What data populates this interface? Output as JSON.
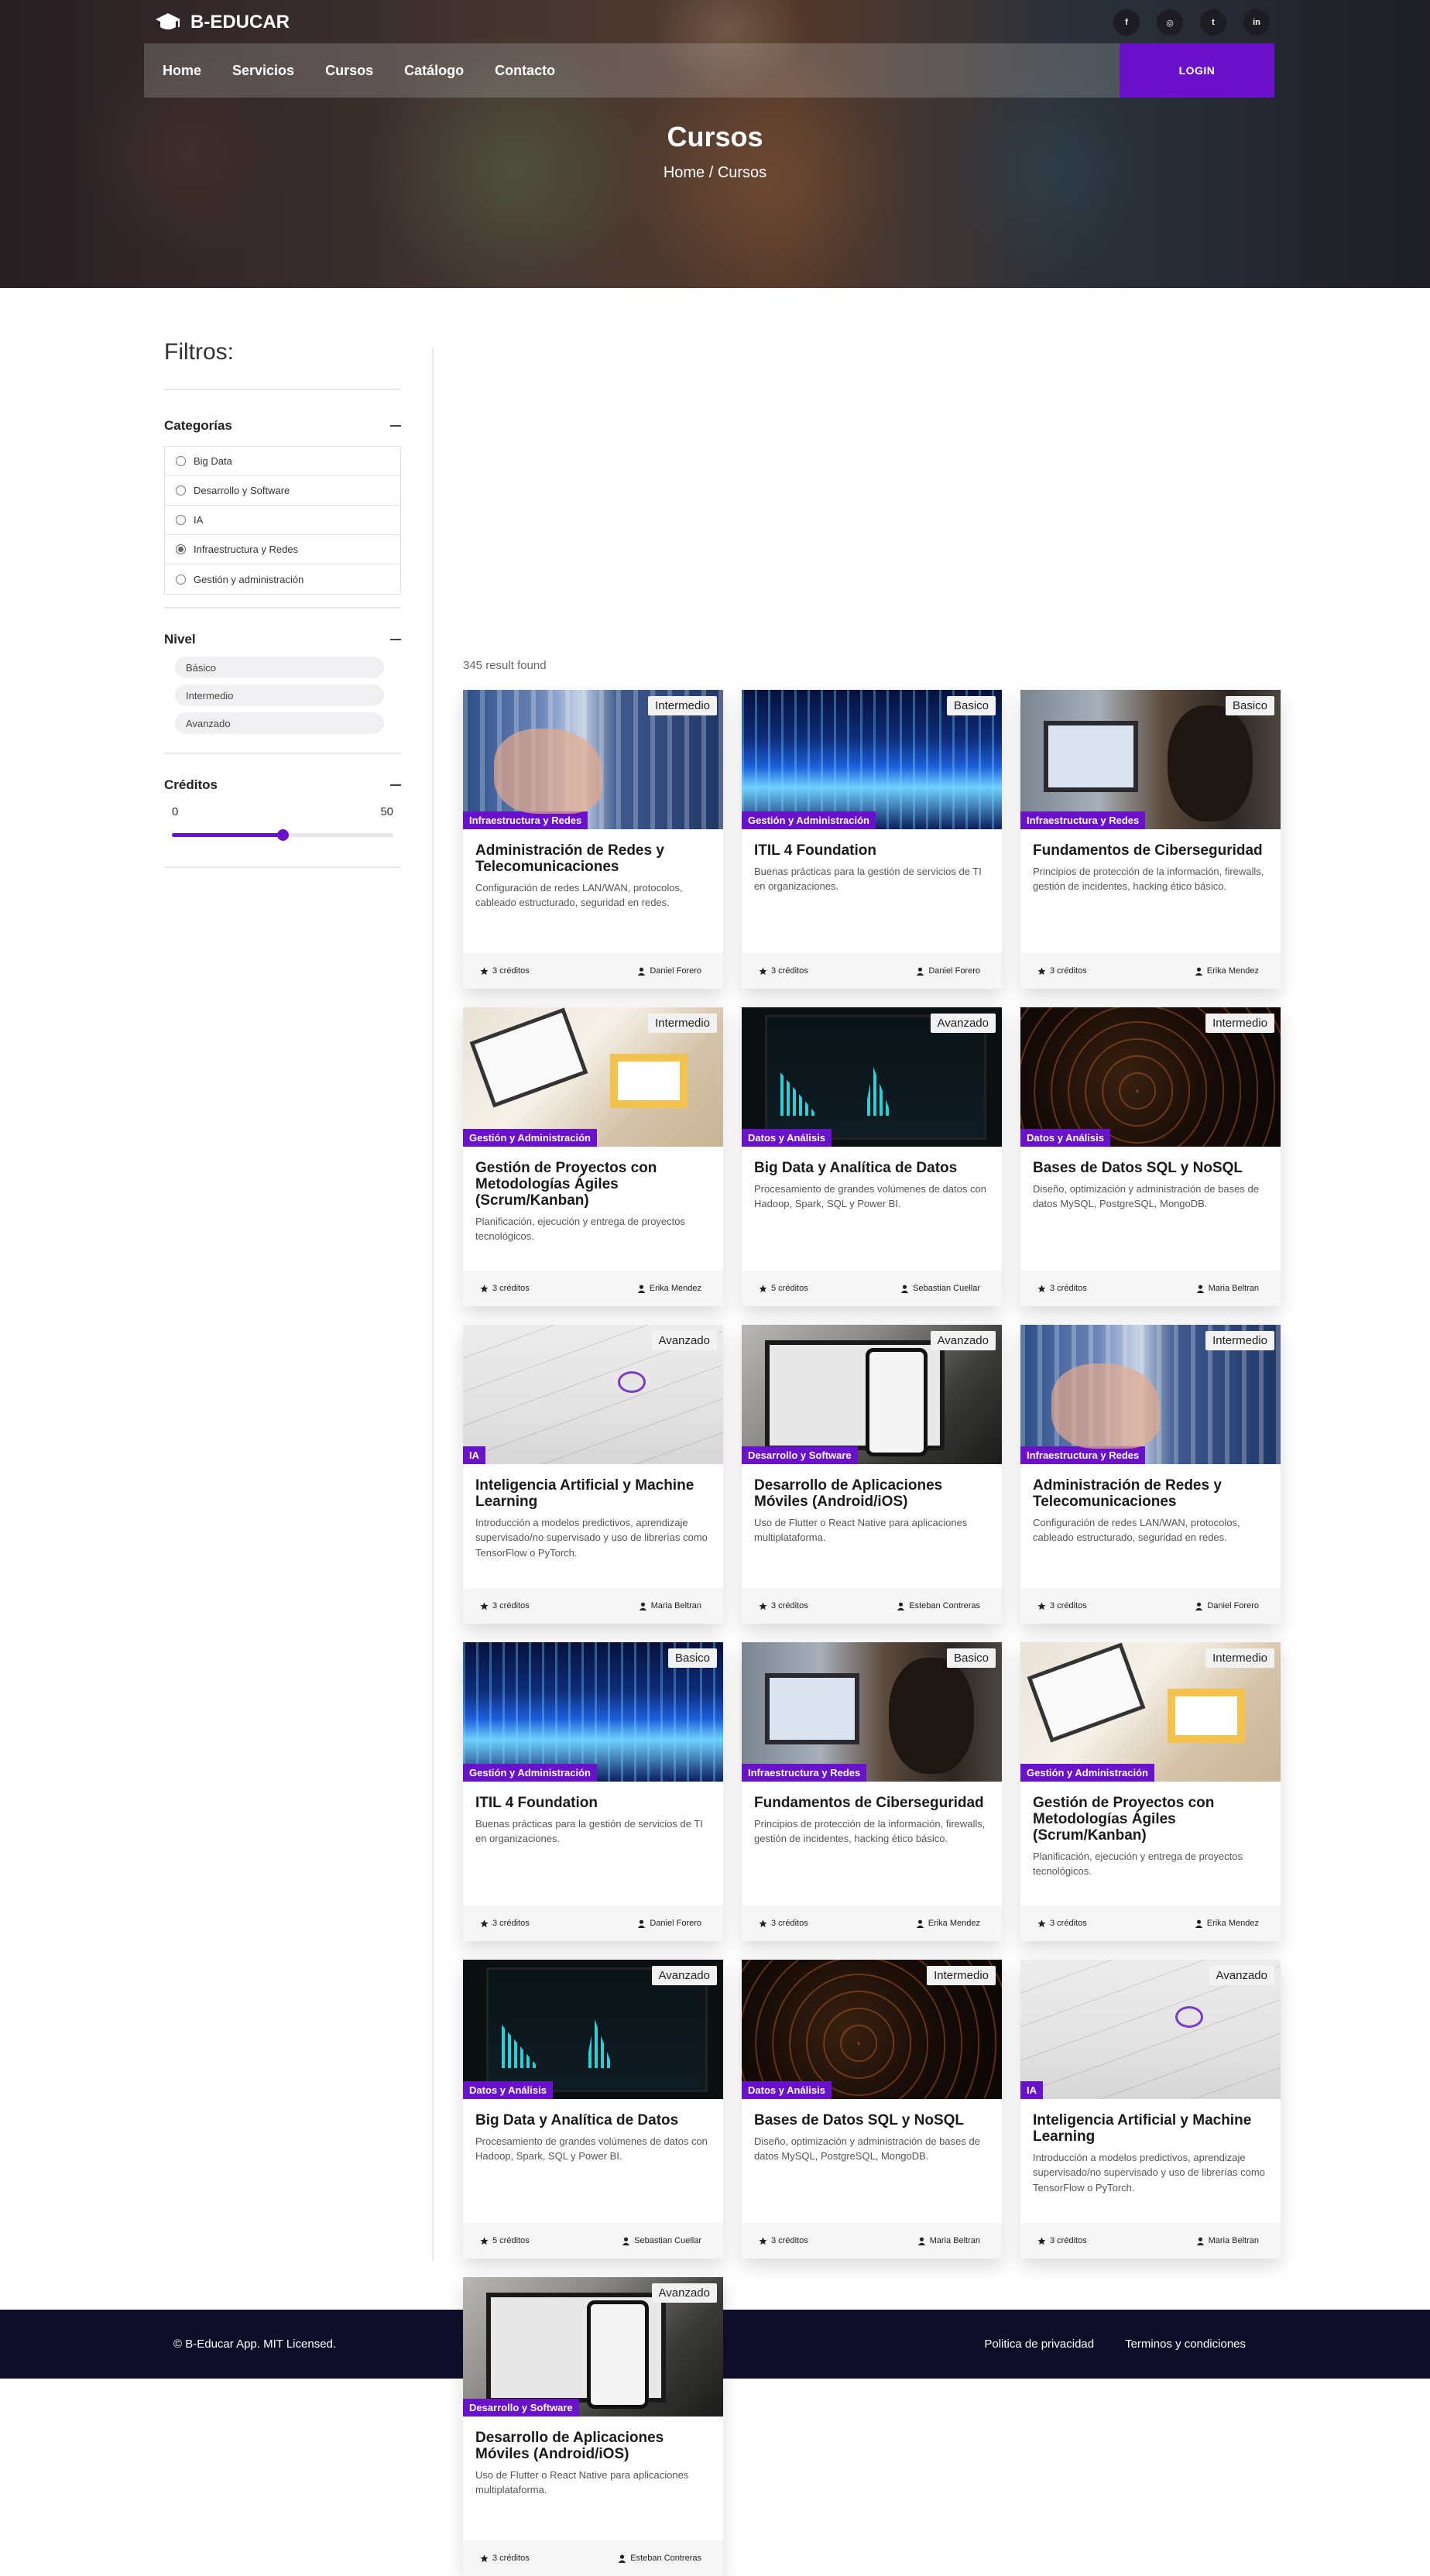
{
  "brand": {
    "name": "B-EDUCAR"
  },
  "socials": [
    {
      "icon": "facebook-icon",
      "glyph": "f"
    },
    {
      "icon": "instagram-icon",
      "glyph": "◎"
    },
    {
      "icon": "twitter-icon",
      "glyph": "t"
    },
    {
      "icon": "linkedin-icon",
      "glyph": "in"
    }
  ],
  "nav": {
    "items": [
      "Home",
      "Servicios",
      "Cursos",
      "Catálogo",
      "Contacto"
    ],
    "login_label": "LOGIN"
  },
  "hero": {
    "title": "Cursos",
    "breadcrumb": "Home / Cursos"
  },
  "filters": {
    "title": "Filtros:",
    "categories": {
      "label": "Categorías",
      "items": [
        {
          "label": "Big Data",
          "selected": false
        },
        {
          "label": "Desarrollo y Software",
          "selected": false
        },
        {
          "label": "IA",
          "selected": false
        },
        {
          "label": "Infraestructura y Redes",
          "selected": true
        },
        {
          "label": "Gestión y administración",
          "selected": false
        }
      ]
    },
    "level": {
      "label": "Nivel",
      "items": [
        "Básico",
        "Intermedio",
        "Avanzado"
      ]
    },
    "credits": {
      "label": "Créditos",
      "min": "0",
      "max": "50",
      "value_fraction": 0.5
    }
  },
  "results": {
    "count_text": "345 result found"
  },
  "colors": {
    "accent": "#6a11cb",
    "footer_bg": "#0f0f2a"
  },
  "courses": [
    {
      "title": "Administración de Redes y Telecomunicaciones",
      "desc": "Configuración de redes LAN/WAN, protocolos, cableado estructurado, seguridad en redes.",
      "level": "Intermedio",
      "category": "Infraestructura y Redes",
      "credits": "3 créditos",
      "teacher": "Daniel Forero",
      "art": "network"
    },
    {
      "title": "ITIL 4 Foundation",
      "desc": "Buenas prácticas para la gestión de servicios de TI en organizaciones.",
      "level": "Basico",
      "category": "Gestión y Administración",
      "credits": "3 créditos",
      "teacher": "Daniel Forero",
      "art": "itil"
    },
    {
      "title": "Fundamentos de Ciberseguridad",
      "desc": "Principios de protección de la información, firewalls, gestión de incidentes, hacking ético básico.",
      "level": "Basico",
      "category": "Infraestructura y Redes",
      "credits": "3 créditos",
      "teacher": "Erika Mendez",
      "art": "cyber"
    },
    {
      "title": "Gestión de Proyectos con Metodologías Ágiles (Scrum/Kanban)",
      "desc": "Planificación, ejecución y entrega de proyectos tecnológicos.",
      "level": "Intermedio",
      "category": "Gestión y Administración",
      "credits": "3 créditos",
      "teacher": "Erika Mendez",
      "art": "pm"
    },
    {
      "title": "Big Data y Analítica de Datos",
      "desc": "Procesamiento de grandes volúmenes de datos con Hadoop, Spark, SQL y Power BI.",
      "level": "Avanzado",
      "category": "Datos y Análisis",
      "credits": "5 créditos",
      "teacher": "Sebastian Cuellar",
      "art": "bigdata"
    },
    {
      "title": "Bases de Datos SQL y NoSQL",
      "desc": "Diseño, optimización y administración de bases de datos MySQL, PostgreSQL, MongoDB.",
      "level": "Intermedio",
      "category": "Datos y Análisis",
      "credits": "3 créditos",
      "teacher": "Maria Beltran",
      "art": "sql"
    },
    {
      "title": "Inteligencia Artificial y Machine Learning",
      "desc": "Introducción a modelos predictivos, aprendizaje supervisado/no supervisado y uso de librerías como TensorFlow o PyTorch.",
      "level": "Avanzado",
      "category": "IA",
      "credits": "3 créditos",
      "teacher": "Maria Beltran",
      "art": "ia"
    },
    {
      "title": "Desarrollo de Aplicaciones Móviles (Android/iOS)",
      "desc": "Uso de Flutter o React Native para aplicaciones multiplataforma.",
      "level": "Avanzado",
      "category": "Desarrollo y Software",
      "credits": "3 créditos",
      "teacher": "Esteban Contreras",
      "art": "mobile"
    },
    {
      "title": "Administración de Redes y Telecomunicaciones",
      "desc": "Configuración de redes LAN/WAN, protocolos, cableado estructurado, seguridad en redes.",
      "level": "Intermedio",
      "category": "Infraestructura y Redes",
      "credits": "3 créditos",
      "teacher": "Daniel Forero",
      "art": "network"
    },
    {
      "title": "ITIL 4 Foundation",
      "desc": "Buenas prácticas para la gestión de servicios de TI en organizaciones.",
      "level": "Basico",
      "category": "Gestión y Administración",
      "credits": "3 créditos",
      "teacher": "Daniel Forero",
      "art": "itil"
    },
    {
      "title": "Fundamentos de Ciberseguridad",
      "desc": "Principios de protección de la información, firewalls, gestión de incidentes, hacking ético básico.",
      "level": "Basico",
      "category": "Infraestructura y Redes",
      "credits": "3 créditos",
      "teacher": "Erika Mendez",
      "art": "cyber"
    },
    {
      "title": "Gestión de Proyectos con Metodologías Ágiles (Scrum/Kanban)",
      "desc": "Planificación, ejecución y entrega de proyectos tecnológicos.",
      "level": "Intermedio",
      "category": "Gestión y Administración",
      "credits": "3 créditos",
      "teacher": "Erika Mendez",
      "art": "pm"
    },
    {
      "title": "Big Data y Analítica de Datos",
      "desc": "Procesamiento de grandes volúmenes de datos con Hadoop, Spark, SQL y Power BI.",
      "level": "Avanzado",
      "category": "Datos y Análisis",
      "credits": "5 créditos",
      "teacher": "Sebastian Cuellar",
      "art": "bigdata"
    },
    {
      "title": "Bases de Datos SQL y NoSQL",
      "desc": "Diseño, optimización y administración de bases de datos MySQL, PostgreSQL, MongoDB.",
      "level": "Intermedio",
      "category": "Datos y Análisis",
      "credits": "3 créditos",
      "teacher": "Maria Beltran",
      "art": "sql"
    },
    {
      "title": "Inteligencia Artificial y Machine Learning",
      "desc": "Introducción a modelos predictivos, aprendizaje supervisado/no supervisado y uso de librerías como TensorFlow o PyTorch.",
      "level": "Avanzado",
      "category": "IA",
      "credits": "3 créditos",
      "teacher": "Maria Beltran",
      "art": "ia"
    },
    {
      "title": "Desarrollo de Aplicaciones Móviles (Android/iOS)",
      "desc": "Uso de Flutter o React Native para aplicaciones multiplataforma.",
      "level": "Avanzado",
      "category": "Desarrollo y Software",
      "credits": "3 créditos",
      "teacher": "Esteban Contreras",
      "art": "mobile"
    }
  ],
  "footer": {
    "copyright": "© B-Educar App. MIT Licensed.",
    "links": [
      "Politica de privacidad",
      "Terminos y condiciones"
    ]
  }
}
